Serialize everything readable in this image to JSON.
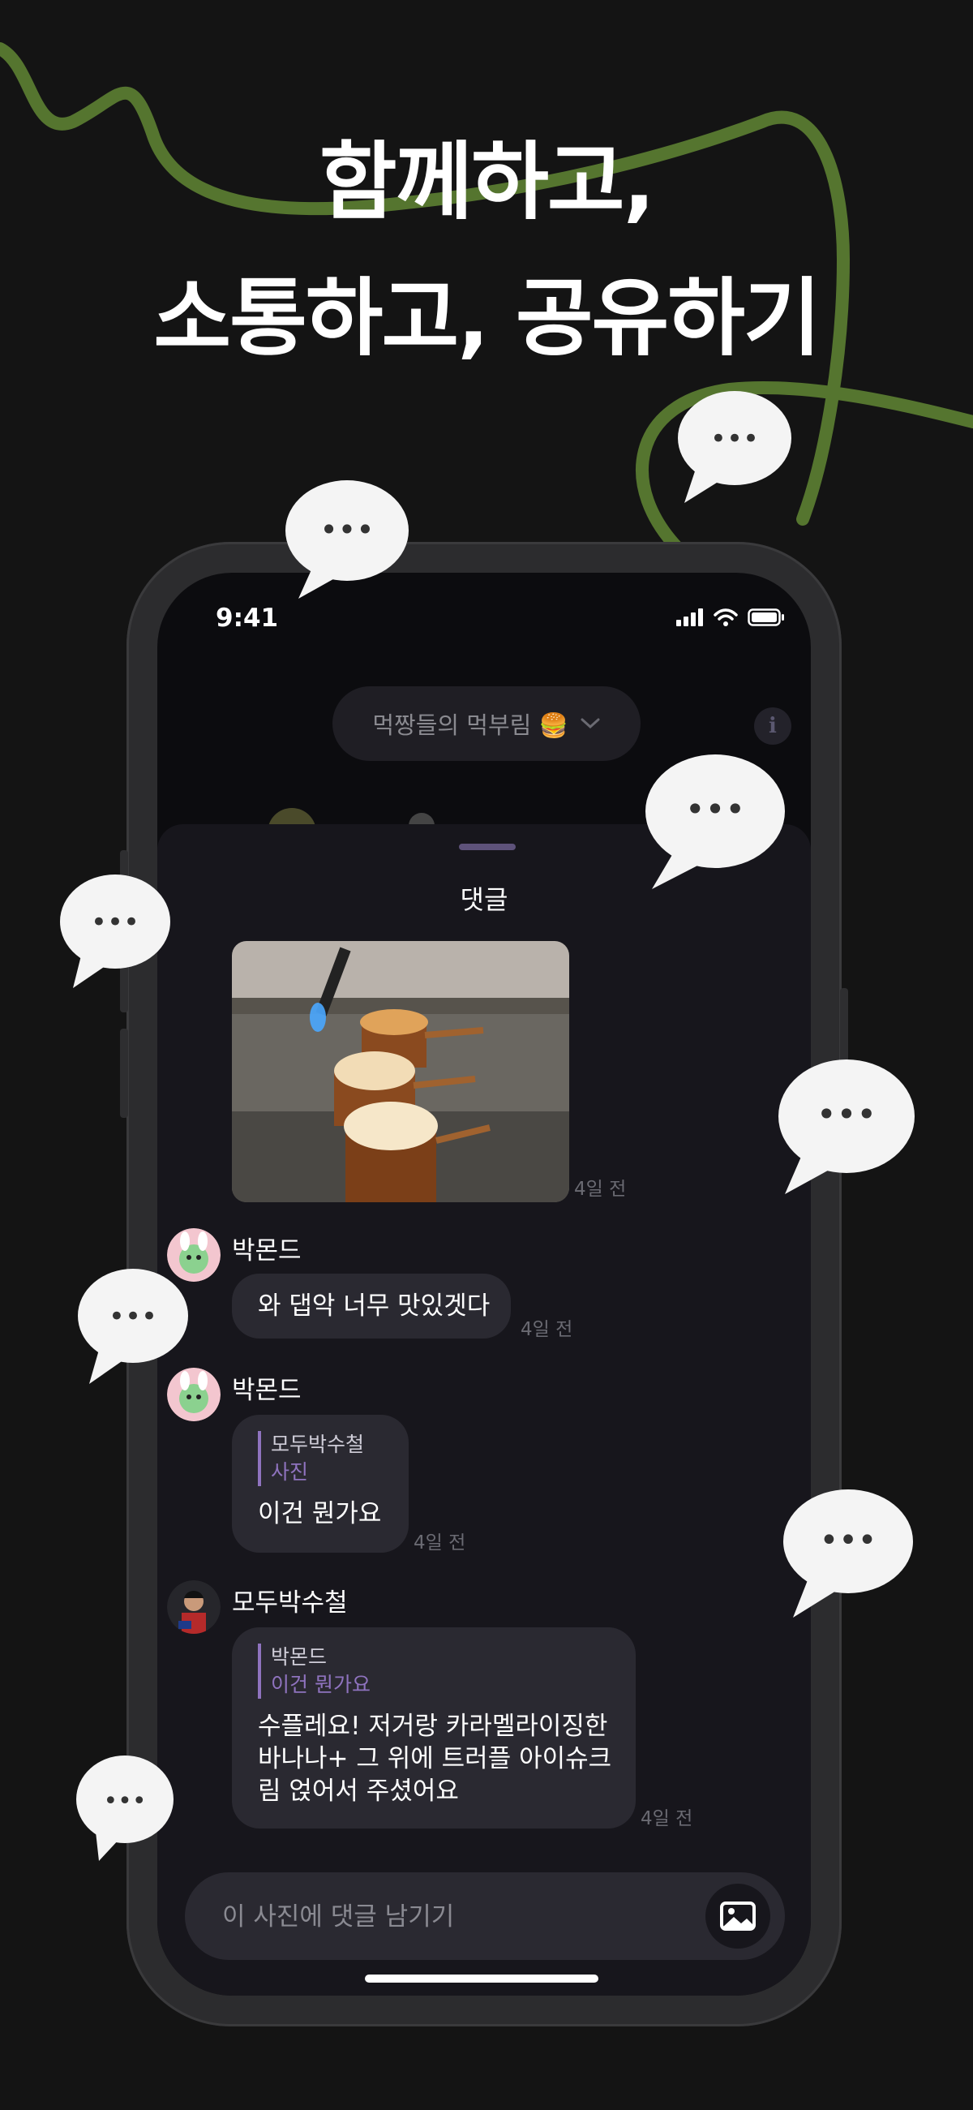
{
  "headline": {
    "line1": "함께하고,",
    "line2": "소통하고, 공유하기"
  },
  "colors": {
    "background": "#141414",
    "accent_green": "#55752f",
    "reply_accent": "#8f73bf",
    "bubble": "#2a2931"
  },
  "status_bar": {
    "time": "9:41",
    "icons": [
      "signal-icon",
      "wifi-icon",
      "battery-icon"
    ]
  },
  "chat_header": {
    "room_name": "먹짱들의 먹부림 🍔",
    "info_label": "i"
  },
  "comments_sheet": {
    "title": "댓글",
    "photo_post": {
      "timestamp": "4일 전"
    },
    "comments": [
      {
        "user": "박몬드",
        "text": "와 댑악 너무 맛있겟다",
        "timestamp": "4일 전"
      },
      {
        "user": "박몬드",
        "reply_to_user": "모두박수철",
        "reply_to_text": "사진",
        "text": "이건 뭔가요",
        "timestamp": "4일 전"
      },
      {
        "user": "모두박수철",
        "reply_to_user": "박몬드",
        "reply_to_text": "이건 뭔가요",
        "text_lines": [
          "수플레요! 저거랑 카라멜라이징한",
          "바나나+ 그 위에 트러플 아이슈크",
          "림 얹어서 주셨어요"
        ],
        "timestamp": "4일 전"
      }
    ]
  },
  "input": {
    "placeholder": "이 사진에 댓글 남기기"
  },
  "decor": {
    "speech_bubble_text": "•••"
  }
}
